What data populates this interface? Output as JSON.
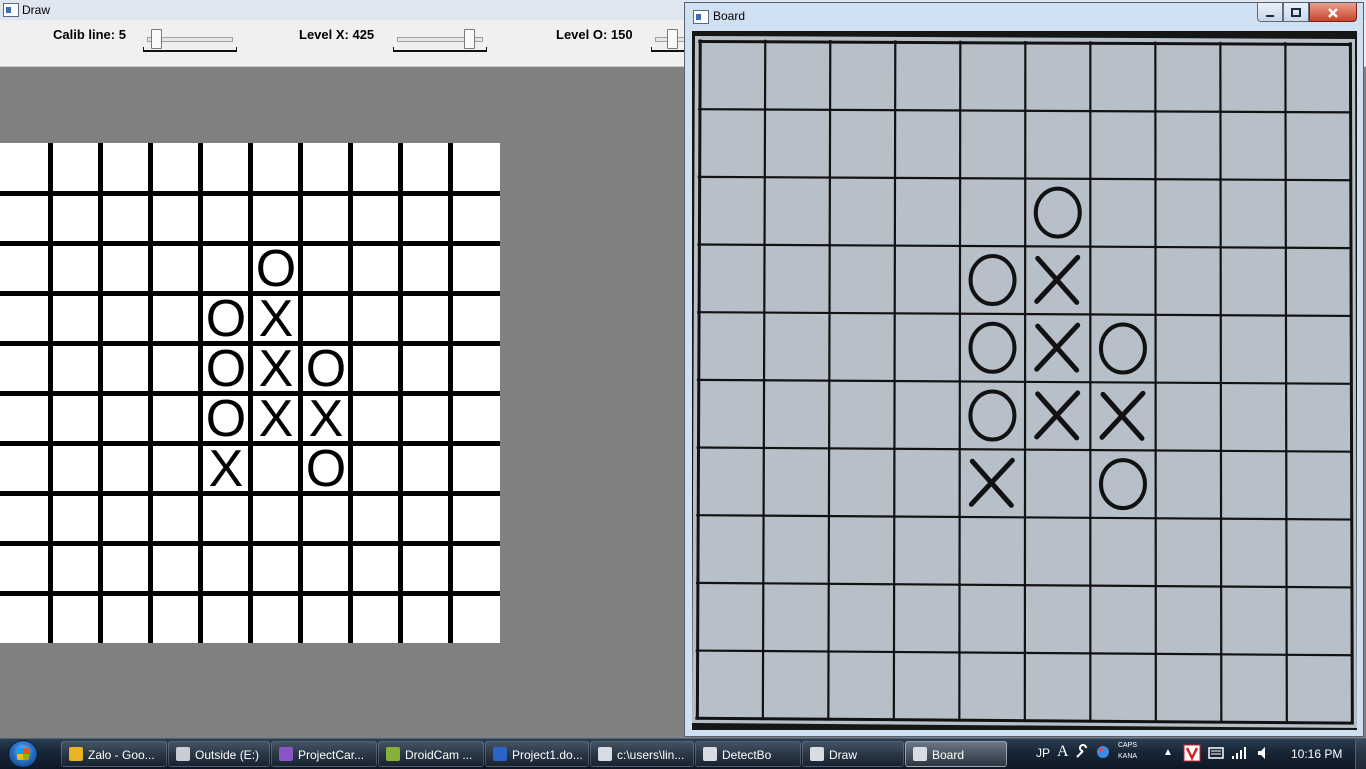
{
  "draw_window": {
    "title": "Draw",
    "sliders": [
      {
        "label": "Calib line: 5",
        "fraction": 0.05
      },
      {
        "label": "Level X: 425",
        "fraction": 0.87
      },
      {
        "label": "Level O: 150",
        "fraction": 0.15
      }
    ],
    "board": {
      "rows": 10,
      "cols": 10,
      "cells": [
        [
          "",
          "",
          "",
          "",
          "",
          "",
          "",
          "",
          "",
          ""
        ],
        [
          "",
          "",
          "",
          "",
          "",
          "",
          "",
          "",
          "",
          ""
        ],
        [
          "",
          "",
          "",
          "",
          "",
          "O",
          "",
          "",
          "",
          ""
        ],
        [
          "",
          "",
          "",
          "",
          "O",
          "X",
          "",
          "",
          "",
          ""
        ],
        [
          "",
          "",
          "",
          "",
          "O",
          "X",
          "O",
          "",
          "",
          ""
        ],
        [
          "",
          "",
          "",
          "",
          "O",
          "X",
          "X",
          "",
          "",
          ""
        ],
        [
          "",
          "",
          "",
          "",
          "X",
          "",
          "O",
          "",
          "",
          ""
        ],
        [
          "",
          "",
          "",
          "",
          "",
          "",
          "",
          "",
          "",
          ""
        ],
        [
          "",
          "",
          "",
          "",
          "",
          "",
          "",
          "",
          "",
          ""
        ],
        [
          "",
          "",
          "",
          "",
          "",
          "",
          "",
          "",
          "",
          ""
        ]
      ]
    }
  },
  "board_window": {
    "title": "Board",
    "minimize_icon": "minimize-icon",
    "maximize_icon": "maximize-icon",
    "close_icon": "close-icon",
    "paper_color": "#b7c0c8",
    "ink_color": "#121212",
    "marks": [
      {
        "row": 2,
        "col": 5,
        "mark": "O"
      },
      {
        "row": 3,
        "col": 4,
        "mark": "O"
      },
      {
        "row": 3,
        "col": 5,
        "mark": "X"
      },
      {
        "row": 4,
        "col": 4,
        "mark": "O"
      },
      {
        "row": 4,
        "col": 5,
        "mark": "X"
      },
      {
        "row": 4,
        "col": 6,
        "mark": "O"
      },
      {
        "row": 5,
        "col": 4,
        "mark": "O"
      },
      {
        "row": 5,
        "col": 5,
        "mark": "X"
      },
      {
        "row": 5,
        "col": 6,
        "mark": "X"
      },
      {
        "row": 6,
        "col": 4,
        "mark": "X"
      },
      {
        "row": 6,
        "col": 6,
        "mark": "O"
      }
    ]
  },
  "taskbar": {
    "start_icon": "windows-start-icon",
    "buttons": [
      {
        "label": "Zalo - Goo...",
        "icon": "chrome-icon",
        "color": "#e8b426",
        "active": false
      },
      {
        "label": "Outside (E:)",
        "icon": "drive-icon",
        "color": "#c9cdd2",
        "active": false
      },
      {
        "label": "ProjectCar...",
        "icon": "visual-studio-icon",
        "color": "#8a55c7",
        "active": false
      },
      {
        "label": "DroidCam ...",
        "icon": "droidcam-icon",
        "color": "#86b23a",
        "active": false
      },
      {
        "label": "Project1.do...",
        "icon": "word-icon",
        "color": "#2b63c6",
        "active": false
      },
      {
        "label": "c:\\users\\lin...",
        "icon": "console-icon",
        "color": "#d9dde2",
        "active": false
      },
      {
        "label": "DetectBo",
        "icon": "window-icon",
        "color": "#d9dde2",
        "active": false
      },
      {
        "label": "Draw",
        "icon": "window-icon",
        "color": "#d9dde2",
        "active": false
      },
      {
        "label": "Board",
        "icon": "window-icon",
        "color": "#d9dde2",
        "active": true
      }
    ],
    "tray": {
      "language": "JP",
      "ime_letter": "A",
      "caps": "CAPS",
      "kana": "KANA",
      "show_hidden": "▲",
      "clock": "10:16 PM"
    }
  }
}
